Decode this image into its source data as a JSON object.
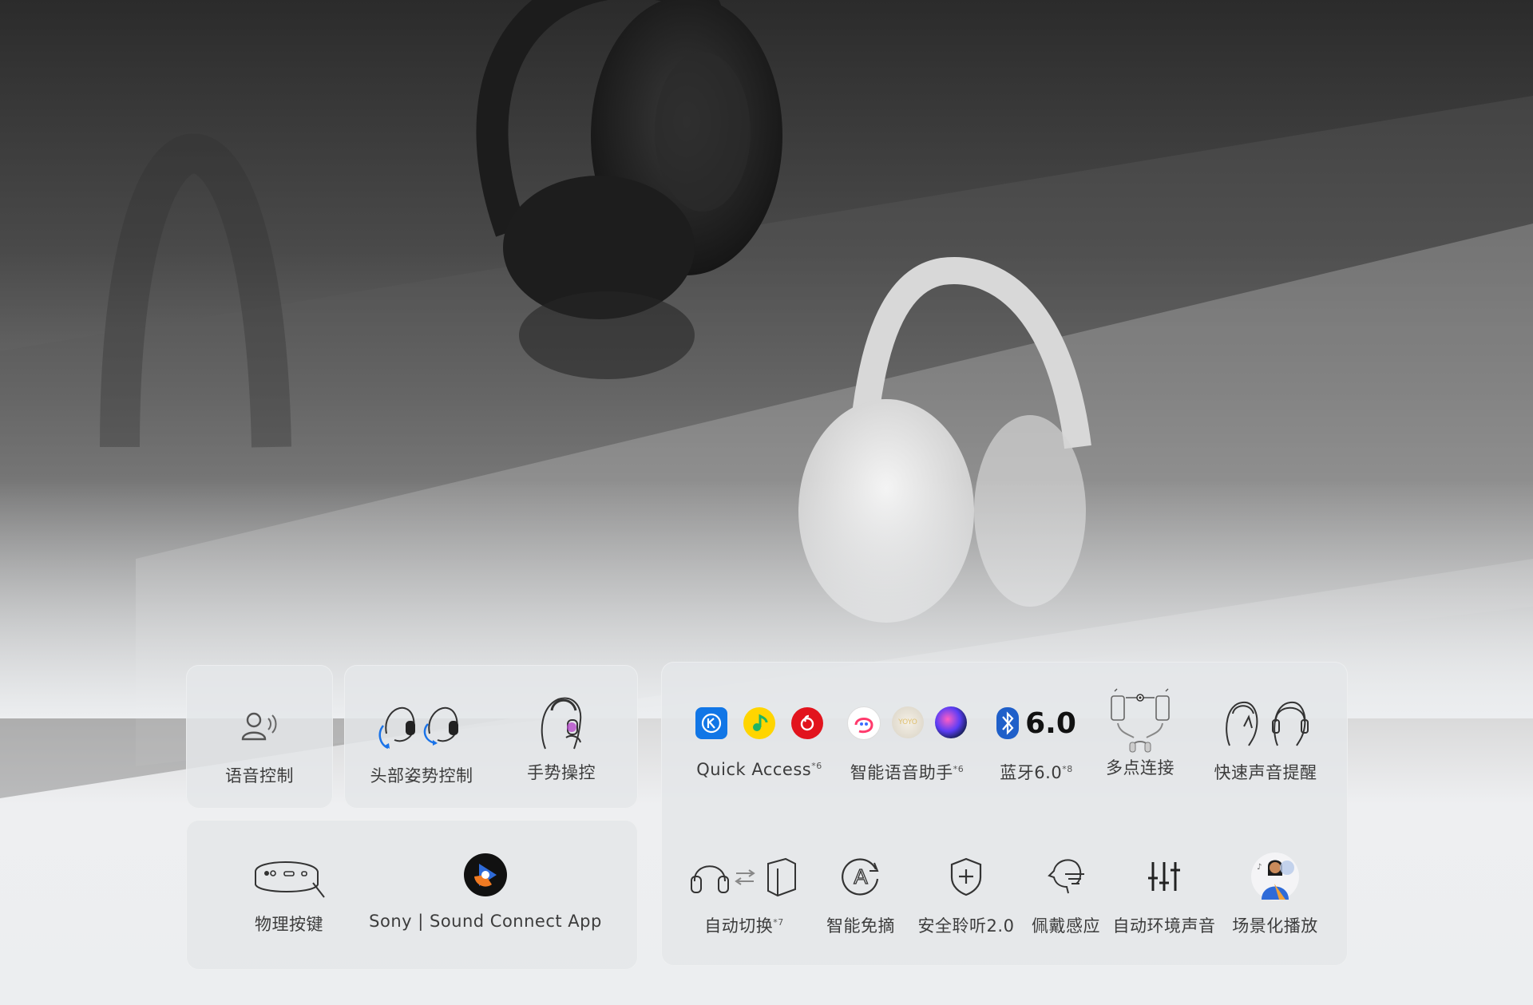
{
  "panel_left_top": {
    "features": [
      {
        "label": "语音控制",
        "icon": "voice-control-icon"
      },
      {
        "label": "头部姿势控制",
        "icon": "head-gesture-icon"
      },
      {
        "label": "手势操控",
        "icon": "hand-gesture-icon"
      }
    ]
  },
  "panel_left_bottom": {
    "features": [
      {
        "label": "物理按键",
        "icon": "physical-buttons-icon"
      },
      {
        "label": "Sony | Sound Connect App",
        "icon": "sound-connect-app-icon"
      }
    ]
  },
  "panel_right": {
    "row1": [
      {
        "label": "Quick Access",
        "note": "*6",
        "icon": "quick-access-apps-icon"
      },
      {
        "label": "智能语音助手",
        "note": "*6",
        "icon": "voice-assistant-icon"
      },
      {
        "label": "蓝牙6.0",
        "note": "*8",
        "icon": "bluetooth-icon",
        "badge": "6.0"
      },
      {
        "label": "多点连接",
        "icon": "multipoint-icon"
      },
      {
        "label": "快速声音提醒",
        "icon": "quick-attention-icon"
      }
    ],
    "row2": [
      {
        "label": "自动切换",
        "note": "*7",
        "icon": "auto-switch-icon"
      },
      {
        "label": "智能免摘",
        "icon": "speak-to-chat-icon"
      },
      {
        "label": "安全聆听2.0",
        "icon": "safe-listening-icon"
      },
      {
        "label": "佩戴感应",
        "icon": "wear-detection-icon"
      },
      {
        "label": "自动环境声音",
        "icon": "ambient-sound-icon"
      },
      {
        "label": "场景化播放",
        "icon": "scene-playback-icon"
      }
    ]
  },
  "colors": {
    "panel_bg": "#e4e6e9",
    "text": "#3c3c3c",
    "accent_blue": "#1a73e8"
  }
}
